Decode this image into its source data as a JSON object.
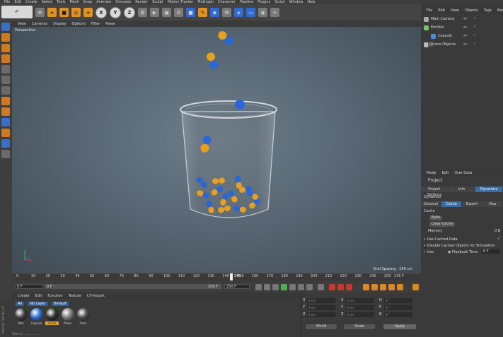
{
  "menubar": [
    "File",
    "Edit",
    "Create",
    "Select",
    "Tools",
    "Mesh",
    "Snap",
    "Animate",
    "Simulate",
    "Render",
    "Sculpt",
    "Motion Tracker",
    "MoGraph",
    "Character",
    "Pipeline",
    "Plugins",
    "Script",
    "Window",
    "Help"
  ],
  "toolbar": {
    "x": "X",
    "y": "Y",
    "z": "Z"
  },
  "viewport": {
    "menu": [
      "View",
      "Cameras",
      "Display",
      "Options",
      "Filter",
      "Panel"
    ],
    "label": "Perspective",
    "grid_spacing": "Grid Spacing : 100 cm"
  },
  "timeline": {
    "ticks": [
      "0",
      "10",
      "20",
      "30",
      "40",
      "50",
      "60",
      "70",
      "80",
      "90",
      "100",
      "110",
      "120",
      "130",
      "140",
      "150",
      "160",
      "170",
      "180",
      "190",
      "200",
      "210",
      "220",
      "230",
      "240",
      "250"
    ],
    "current_frame": "145",
    "frame_readout": "145 F",
    "start_field": "0 F",
    "min_field": "0 F",
    "max_field": "250 F",
    "end_field": "250 F"
  },
  "material_manager": {
    "menu": [
      "Create",
      "Edit",
      "Function",
      "Texture",
      "CV-Import"
    ],
    "filters": [
      "All",
      "No Layer",
      "Default"
    ],
    "materials": [
      {
        "label": "Mat",
        "color": "#3b3b3b"
      },
      {
        "label": "Capsule",
        "color": "#2f6fd0"
      },
      {
        "label": "Glass",
        "color": "#303030"
      },
      {
        "label": "Plane",
        "color": "#7a7a7a"
      },
      {
        "label": "Floor",
        "color": "#4a4a4a"
      }
    ],
    "branding": "MAXON CINEMA 4D",
    "status": "Time in: ........ ... ..."
  },
  "coordinates": {
    "rows": [
      {
        "axis": "X",
        "value": "0 cm",
        "axis2": "X",
        "value2": "0 cm",
        "axis3": "H",
        "value3": "0 °"
      },
      {
        "axis": "Y",
        "value": "0 cm",
        "axis2": "Y",
        "value2": "0 cm",
        "axis3": "P",
        "value3": "0 °"
      },
      {
        "axis": "Z",
        "value": "0 cm",
        "axis2": "Z",
        "value2": "0 cm",
        "axis3": "B",
        "value3": "0 °"
      }
    ],
    "world_label": "World",
    "scale_label": "Scale",
    "apply_label": "Apply"
  },
  "object_manager": {
    "menu": [
      "File",
      "Edit",
      "View",
      "Objects",
      "Tags",
      "Bookmarks"
    ],
    "objects": [
      {
        "name": "Main Camera",
        "indent": 0,
        "color": "#aaaaaa"
      },
      {
        "name": "Emitter",
        "indent": 0,
        "color": "#7bc36b"
      },
      {
        "name": "Capsule",
        "indent": 1,
        "color": "#4a90e2"
      },
      {
        "name": "scene Objects",
        "indent": 0,
        "color": "#bbbbbb"
      }
    ],
    "layer_badge": "L0"
  },
  "attribute_manager": {
    "menu": [
      "Mode",
      "Edit",
      "User Data"
    ],
    "title": "Project",
    "tabs1": [
      {
        "label": "Project Settings",
        "active": false
      },
      {
        "label": "Info",
        "active": false
      },
      {
        "label": "Dynamics",
        "active": true
      }
    ],
    "tabs2": [
      {
        "label": "General",
        "active": false
      },
      {
        "label": "Cache",
        "active": true
      },
      {
        "label": "Expert",
        "active": false
      },
      {
        "label": "Visu",
        "active": false
      }
    ],
    "section_dynamics": "Dynamics",
    "section_cache": "Cache",
    "bake_label": "Bake",
    "clear_cache_label": "Clear Cache",
    "memory_label": "Memory",
    "memory_value": "0 B",
    "use_cached_label": "Use Cached Data",
    "disable_label": "Disable Cached Objects for Simulation",
    "use_label": "Use",
    "playback_time_label": "Playback Time",
    "playback_time_value": "0 F"
  }
}
